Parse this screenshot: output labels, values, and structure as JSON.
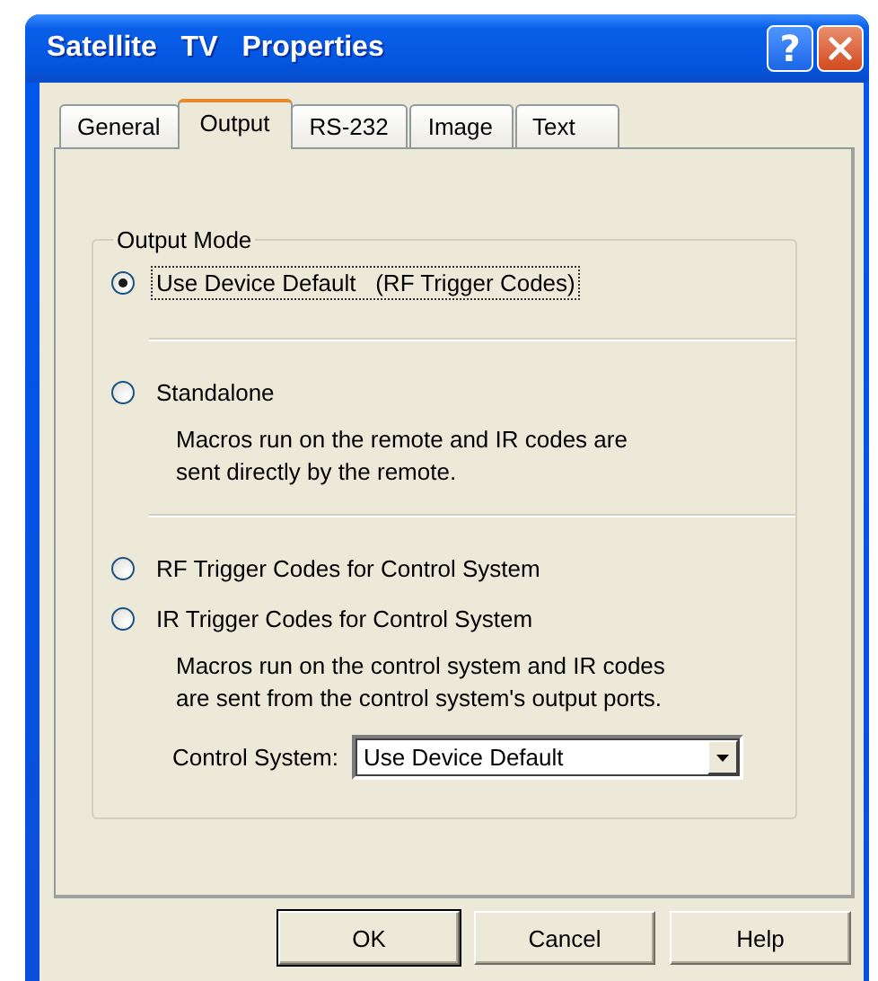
{
  "window": {
    "title": "Satellite TV Properties",
    "help_button": "?"
  },
  "tabs": [
    {
      "label": "General",
      "selected": false
    },
    {
      "label": "Output",
      "selected": true
    },
    {
      "label": "RS-232",
      "selected": false
    },
    {
      "label": "Image",
      "selected": false
    },
    {
      "label": "Text",
      "selected": false
    }
  ],
  "output_mode": {
    "title": "Output Mode",
    "items": [
      {
        "kind": "radio",
        "label": "Use Device Default   (RF Trigger Codes)",
        "selected": true,
        "focused": true
      },
      {
        "kind": "separator"
      },
      {
        "kind": "radio",
        "label": "Standalone",
        "selected": false,
        "focused": false,
        "description": "Macros run on the remote and IR codes are\nsent directly by the remote."
      },
      {
        "kind": "separator"
      },
      {
        "kind": "radio",
        "label": "RF Trigger Codes for Control System",
        "selected": false,
        "focused": false
      },
      {
        "kind": "radio",
        "label": "IR Trigger Codes for Control System",
        "selected": false,
        "focused": false,
        "description": "Macros run on the control system and IR codes\nare sent from the control system's output ports."
      }
    ],
    "control_system": {
      "label": "Control System:",
      "value": "Use Device Default"
    }
  },
  "buttons": [
    {
      "label": "OK",
      "default": true
    },
    {
      "label": "Cancel",
      "default": false
    },
    {
      "label": "Help",
      "default": false
    }
  ]
}
